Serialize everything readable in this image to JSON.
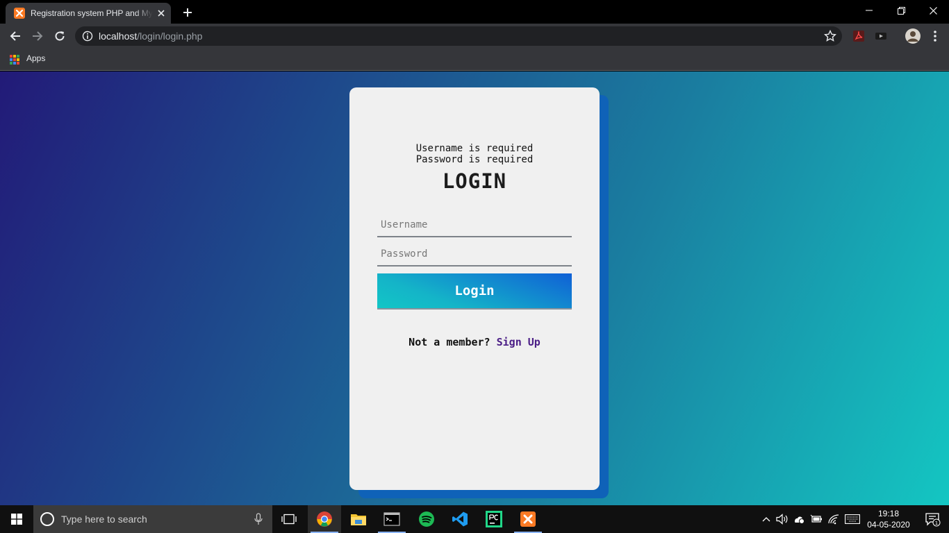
{
  "browser": {
    "tab_title": "Registration system PHP and MySQL",
    "url_host": "localhost",
    "url_path": "/login/login.php",
    "bookmarks": {
      "apps_label": "Apps"
    }
  },
  "login": {
    "errors": [
      "Username is required",
      "Password is required"
    ],
    "title": "LOGIN",
    "username_placeholder": "Username",
    "password_placeholder": "Password",
    "button_label": "Login",
    "signup_prompt": "Not a member?",
    "signup_link": "Sign Up"
  },
  "taskbar": {
    "search_placeholder": "Type here to search",
    "time": "19:18",
    "date": "04-05-2020",
    "notification_count": "1",
    "apps": [
      "task-view",
      "chrome",
      "file-explorer",
      "terminal",
      "spotify",
      "vscode",
      "pycharm",
      "xampp"
    ]
  },
  "colors": {
    "accent_link": "#4a1d86",
    "button_gradient_start": "#1060d6",
    "button_gradient_end": "#12c6c6",
    "page_gradient_start": "#221a78",
    "page_gradient_end": "#14c6c2"
  }
}
